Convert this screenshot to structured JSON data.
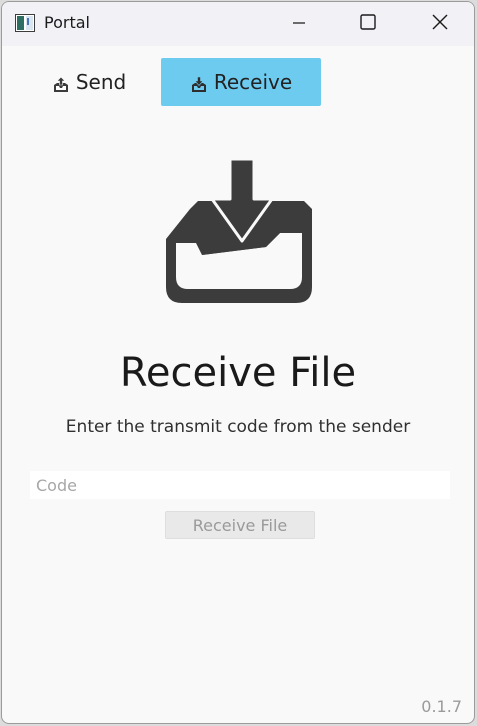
{
  "window": {
    "title": "Portal",
    "icon": "app-window-icon",
    "controls": {
      "minimize_icon": "minimize-icon",
      "maximize_icon": "maximize-icon",
      "close_icon": "close-icon"
    }
  },
  "tabs": [
    {
      "label": "Send",
      "icon": "send-inbox-icon",
      "selected": false
    },
    {
      "label": "Receive",
      "icon": "receive-inbox-icon",
      "selected": true
    }
  ],
  "main": {
    "hero_icon": "download-tray-icon",
    "heading": "Receive File",
    "instruction": "Enter the transmit code from the sender",
    "code_input": {
      "value": "",
      "placeholder": "Code"
    },
    "receive_button_label": "Receive File",
    "receive_button_enabled": false
  },
  "footer": {
    "version": "0.1.7"
  },
  "colors": {
    "accent": "#6ecbf0",
    "icon_dark": "#3c3c3c",
    "background": "#f9f9f9"
  }
}
